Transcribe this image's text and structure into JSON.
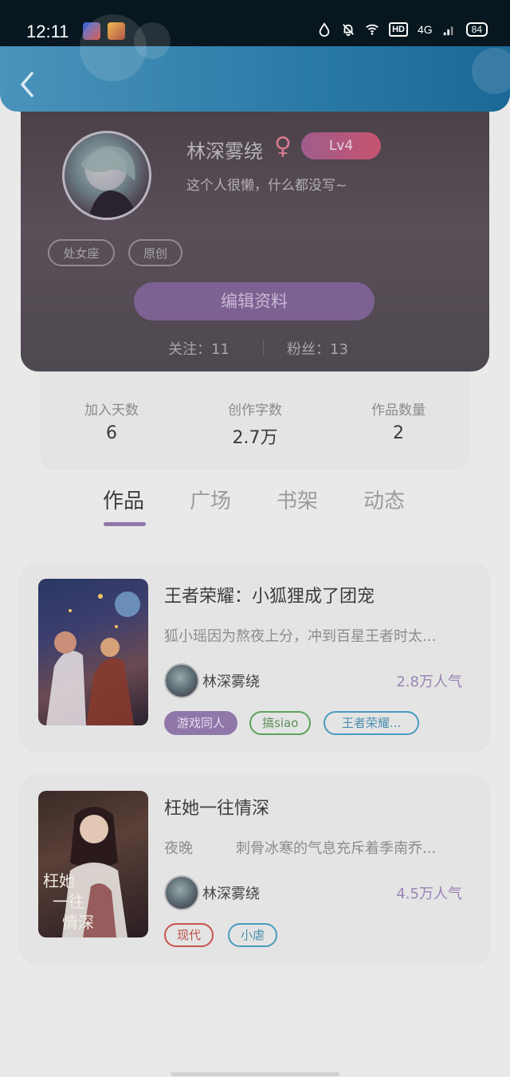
{
  "status_bar": {
    "time": "12:11",
    "hd": "HD",
    "network": "4G",
    "battery": "84"
  },
  "profile": {
    "name": "林深雾绕",
    "gender_symbol": "♀",
    "level": "Lv4",
    "bio": "这个人很懒，什么都没写~",
    "tags": [
      "处女座",
      "原创"
    ],
    "edit_button": "编辑资料",
    "following": "关注：11",
    "followers": "粉丝：13"
  },
  "stats": [
    {
      "label": "加入天数",
      "value": "6"
    },
    {
      "label": "创作字数",
      "value": "2.7万"
    },
    {
      "label": "作品数量",
      "value": "2"
    }
  ],
  "tabs": [
    "作品",
    "广场",
    "书架",
    "动态"
  ],
  "active_tab": "作品",
  "works": [
    {
      "title": "王者荣耀：小狐狸成了团宠",
      "desc": "狐小瑶因为熬夜上分，冲到百星王者时太...",
      "author": "林深雾绕",
      "popularity": "2.8万人气",
      "tags": [
        {
          "label": "游戏同人",
          "style": "filled-purple"
        },
        {
          "label": "搞siao",
          "style": "outline-green"
        },
        {
          "label": "王者荣耀...",
          "style": "outline-blue"
        }
      ]
    },
    {
      "title": "枉她一往情深",
      "desc": "夜晚　　　刺骨冰寒的气息充斥着季南乔...",
      "author": "林深雾绕",
      "popularity": "4.5万人气",
      "tags": [
        {
          "label": "现代",
          "style": "outline-red"
        },
        {
          "label": "小虐",
          "style": "outline-blue"
        }
      ]
    }
  ],
  "colors": {
    "accent": "#8f78a9",
    "header_blue": "#2a7aa6",
    "card_bg": "#e4e4e4"
  }
}
